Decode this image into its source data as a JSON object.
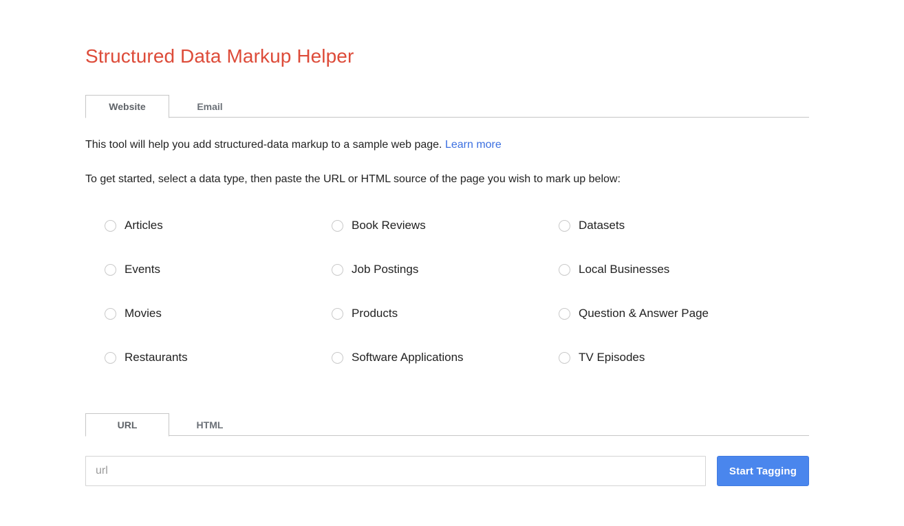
{
  "app": {
    "title": "Structured Data Markup Helper",
    "title_color": "#dd4b39"
  },
  "top_tabs": {
    "items": [
      {
        "label": "Website",
        "active": true
      },
      {
        "label": "Email",
        "active": false
      }
    ]
  },
  "intro": {
    "line1_before_link": "This tool will help you add structured-data markup to a sample web page. ",
    "learn_more_label": "Learn more",
    "learn_more_color": "#3b6fe0",
    "line2": "To get started, select a data type, then paste the URL or HTML source of the page you wish to mark up below:"
  },
  "data_types": {
    "selected": null,
    "options": [
      {
        "label": "Articles",
        "selected": false
      },
      {
        "label": "Book Reviews",
        "selected": false
      },
      {
        "label": "Datasets",
        "selected": false
      },
      {
        "label": "Events",
        "selected": false
      },
      {
        "label": "Job Postings",
        "selected": false
      },
      {
        "label": "Local Businesses",
        "selected": false
      },
      {
        "label": "Movies",
        "selected": false
      },
      {
        "label": "Products",
        "selected": false
      },
      {
        "label": "Question & Answer Page",
        "selected": false
      },
      {
        "label": "Restaurants",
        "selected": false
      },
      {
        "label": "Software Applications",
        "selected": false
      },
      {
        "label": "TV Episodes",
        "selected": false
      }
    ]
  },
  "source_tabs": {
    "items": [
      {
        "label": "URL",
        "active": true
      },
      {
        "label": "HTML",
        "active": false
      }
    ]
  },
  "source_input": {
    "placeholder": "url",
    "value": ""
  },
  "actions": {
    "start_tagging_label": "Start Tagging",
    "start_tagging_color": "#4a86ed"
  }
}
